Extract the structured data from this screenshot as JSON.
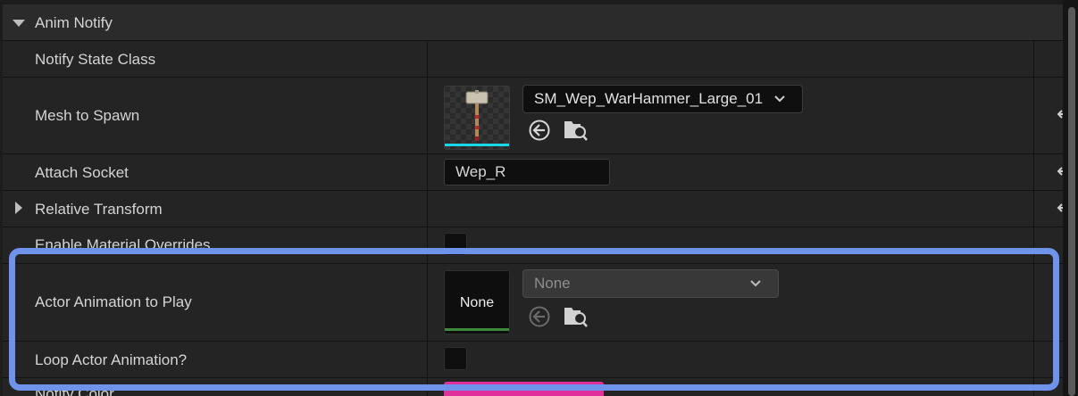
{
  "section": {
    "title": "Anim Notify"
  },
  "rows": {
    "notify_state_class": {
      "label": "Notify State Class"
    },
    "mesh_to_spawn": {
      "label": "Mesh to Spawn",
      "asset": "SM_Wep_WarHammer_Large_01"
    },
    "attach_socket": {
      "label": "Attach Socket",
      "value": "Wep_R"
    },
    "relative_transform": {
      "label": "Relative Transform"
    },
    "enable_material_overrides": {
      "label": "Enable Material Overrides"
    },
    "actor_animation": {
      "label": "Actor Animation to Play",
      "thumb_text": "None",
      "asset": "None"
    },
    "loop_actor_animation": {
      "label": "Loop Actor Animation?"
    },
    "notify_color": {
      "label": "Notify Color"
    }
  },
  "colors": {
    "highlight": "#6f92ea",
    "mesh_thumb_bar": "#18d8e8",
    "anim_thumb_bar": "#3d8a3d",
    "notify_color_swatch": "#e0309c"
  },
  "icons": [
    "expand-triangle-icon",
    "collapse-triangle-icon",
    "reset-to-default-icon",
    "browse-arrow-icon",
    "find-in-browser-icon",
    "chevron-down-icon"
  ]
}
